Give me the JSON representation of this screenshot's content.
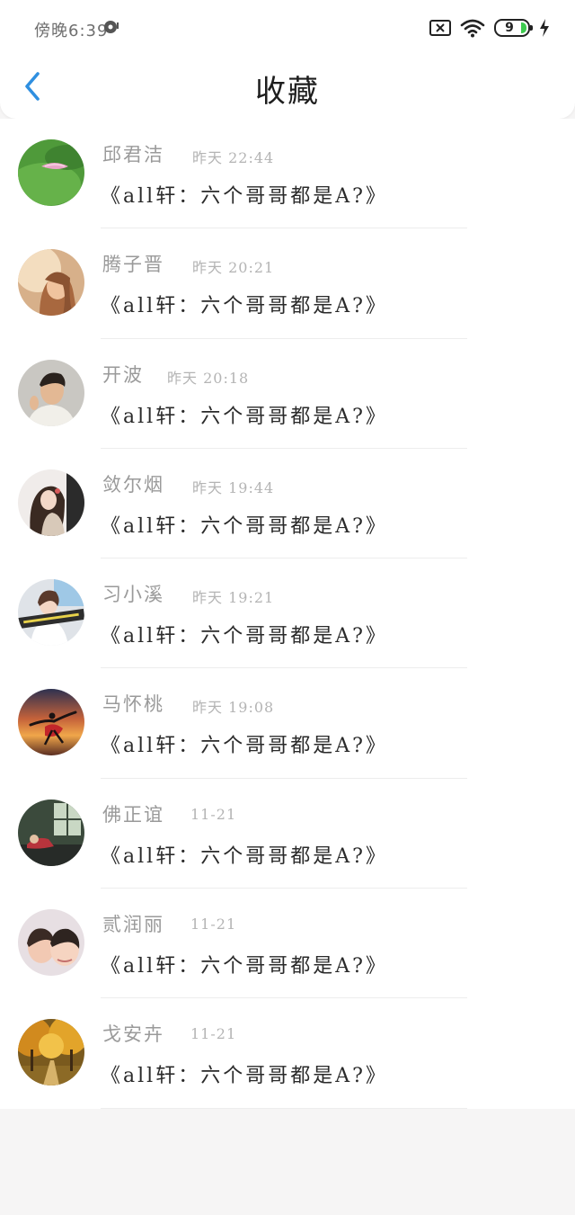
{
  "status_bar": {
    "time": "傍晚6:39",
    "battery": "9"
  },
  "header": {
    "title": "收藏"
  },
  "colors": {
    "accent": "#2f8fe0",
    "battery_fill": "#3ecb4f"
  },
  "favorites": [
    {
      "name": "邱君洁",
      "time": "昨天 22:44",
      "title": "《all轩：六个哥哥都是A?》",
      "avatar": "avatar-lotus-leaf"
    },
    {
      "name": "腾子晋",
      "time": "昨天 20:21",
      "title": "《all轩：六个哥哥都是A?》",
      "avatar": "avatar-girl-sunlight"
    },
    {
      "name": "开波",
      "time": "昨天 20:18",
      "title": "《all轩：六个哥哥都是A?》",
      "avatar": "avatar-young-man"
    },
    {
      "name": "敛尔烟",
      "time": "昨天 19:44",
      "title": "《all轩：六个哥哥都是A?》",
      "avatar": "avatar-girl-long-hair"
    },
    {
      "name": "习小溪",
      "time": "昨天 19:21",
      "title": "《all轩：六个哥哥都是A?》",
      "avatar": "avatar-girl-caption"
    },
    {
      "name": "马怀桃",
      "time": "昨天 19:08",
      "title": "《all轩：六个哥哥都是A?》",
      "avatar": "avatar-dancer-sunset"
    },
    {
      "name": "佛正谊",
      "time": "11-21",
      "title": "《all轩：六个哥哥都是A?》",
      "avatar": "avatar-room-window"
    },
    {
      "name": "贰润丽",
      "time": "11-21",
      "title": "《all轩：六个哥哥都是A?》",
      "avatar": "avatar-children-faces"
    },
    {
      "name": "戈安卉",
      "time": "11-21",
      "title": "《all轩：六个哥哥都是A?》",
      "avatar": "avatar-autumn-trees"
    }
  ]
}
